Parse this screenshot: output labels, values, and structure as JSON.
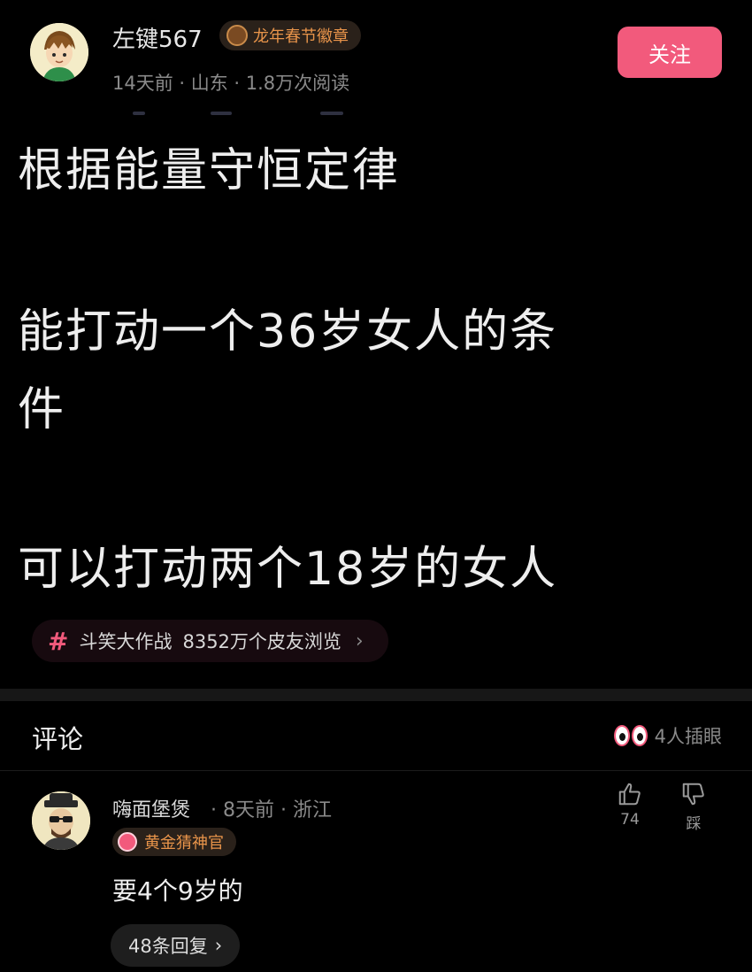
{
  "post": {
    "author": {
      "name": "左键567",
      "badge": "龙年春节徽章",
      "meta": "14天前 · 山东 · 1.8万次阅读"
    },
    "follow_label": "关注",
    "lines": [
      "根据能量守恒定律",
      "能打动一个36岁女人的条",
      "件",
      "可以打动两个18岁的女人"
    ],
    "topic": {
      "name": "斗笑大作战",
      "views": "8352万个皮友浏览"
    }
  },
  "comments_section": {
    "title": "评论",
    "stalkers": "4人插眼"
  },
  "comment": {
    "author": "嗨面堡煲",
    "meta": "· 8天前 · 浙江",
    "badge": "黄金猜神官",
    "text": "要4个9岁的",
    "replies_label": "48条回复",
    "likes": "74",
    "dislike_label": "踩"
  },
  "colors": {
    "accent": "#f25a7c",
    "badge_text": "#e8944a",
    "background": "#000000"
  },
  "icons": [
    "hash-icon",
    "eyes-icon",
    "thumbs-up-icon",
    "thumbs-down-icon",
    "chevron-right-icon"
  ]
}
